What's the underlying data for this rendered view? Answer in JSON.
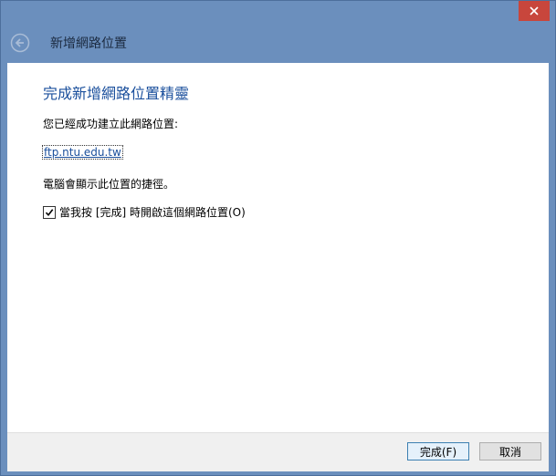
{
  "window": {
    "close_glyph": "close-icon",
    "title": "新增網路位置"
  },
  "content": {
    "heading": "完成新增網路位置精靈",
    "success_text": "您已經成功建立此網路位置:",
    "location": "ftp.ntu.edu.tw",
    "shortcut_text": "電腦會顯示此位置的捷徑。",
    "checkbox": {
      "label": "當我按 [完成] 時開啟這個網路位置(O)",
      "checked": true
    }
  },
  "footer": {
    "finish_label": "完成(F)",
    "cancel_label": "取消"
  },
  "colors": {
    "frame": "#6b8fbd",
    "heading": "#1a4f9c",
    "close": "#c8463c"
  }
}
